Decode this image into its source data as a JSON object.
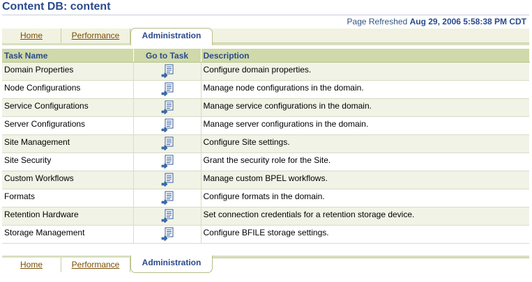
{
  "page": {
    "title": "Content DB: content",
    "refreshed_label": "Page Refreshed",
    "refreshed_time": "Aug 29, 2006 5:58:38 PM CDT"
  },
  "tabs": {
    "home": "Home",
    "performance": "Performance",
    "administration": "Administration"
  },
  "table": {
    "headers": {
      "task_name": "Task Name",
      "go_to_task": "Go to Task",
      "description": "Description"
    },
    "rows": [
      {
        "name": "Domain Properties",
        "description": "Configure domain properties."
      },
      {
        "name": "Node Configurations",
        "description": "Manage node configurations in the domain."
      },
      {
        "name": "Service Configurations",
        "description": "Manage service configurations in the domain."
      },
      {
        "name": "Server Configurations",
        "description": "Manage server configurations in the domain."
      },
      {
        "name": "Site Management",
        "description": "Configure Site settings."
      },
      {
        "name": "Site Security",
        "description": "Grant the security role for the Site."
      },
      {
        "name": "Custom Workflows",
        "description": "Manage custom BPEL workflows."
      },
      {
        "name": "Formats",
        "description": "Configure formats in the domain."
      },
      {
        "name": "Retention Hardware",
        "description": "Set connection credentials for a retention storage device."
      },
      {
        "name": "Storage Management",
        "description": "Configure BFILE storage settings."
      }
    ]
  },
  "icons": {
    "go_to_task": "go-to-task-icon"
  },
  "colors": {
    "title": "#2a4a8c",
    "header_bg": "#cfd9a9",
    "tab_link": "#7a4b00",
    "row_alt": "#f1f3e6"
  }
}
